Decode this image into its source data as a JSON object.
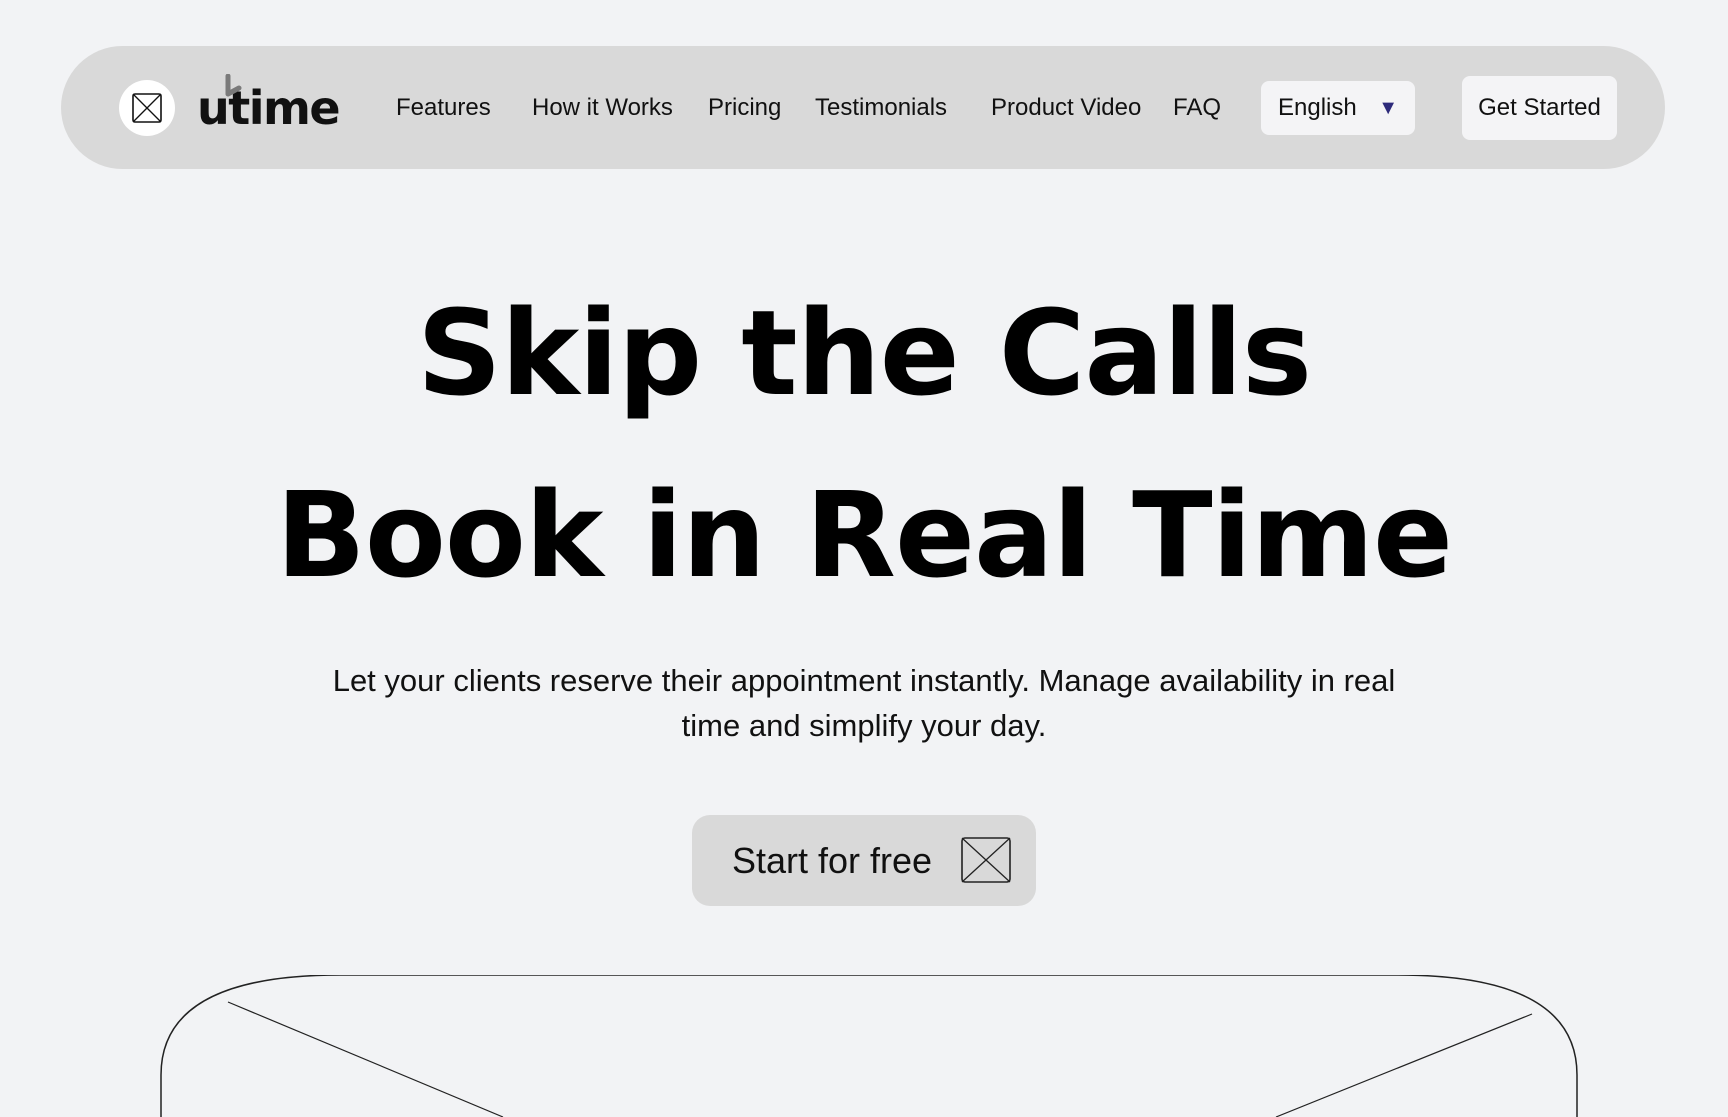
{
  "brand": {
    "logo_text": "utime",
    "logo_icon": "image-placeholder-icon",
    "hand_icon": "pointer-hand-icon"
  },
  "nav": {
    "links": [
      "Features",
      "How it Works",
      "Pricing",
      "Testimonials",
      "Product Video",
      "FAQ"
    ],
    "language": {
      "selected": "English",
      "arrow_icon": "triangle-down-icon",
      "arrow_color": "#2d2a7a"
    },
    "cta_label": "Get Started"
  },
  "hero": {
    "title_line1": "Skip the Calls",
    "title_line2": "Book in Real Time",
    "subtitle": "Let your clients reserve their appointment instantly. Manage availability in real time and simplify your day.",
    "cta_label": "Start for free",
    "cta_icon": "image-placeholder-icon"
  },
  "preview": {
    "icon": "image-placeholder-icon"
  },
  "colors": {
    "background": "#f2f3f5",
    "nav_background": "#d9d9d9",
    "button_background": "#d9d9d9",
    "pill_background": "#f4f4f6"
  }
}
